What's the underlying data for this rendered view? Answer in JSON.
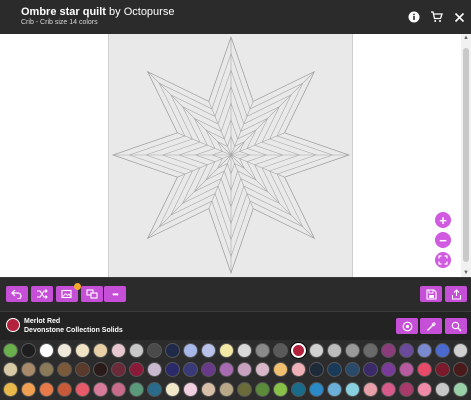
{
  "header": {
    "title": "Ombre star quilt",
    "by_author": "by Octopurse",
    "subtitle": "Crib - Crib size 14 colors"
  },
  "icons": {
    "info": "info-icon",
    "cart": "cart-icon",
    "close": "close-icon",
    "undo": "undo-icon",
    "shuffle": "shuffle-icon",
    "add_photo": "add-photo-icon",
    "swap": "swap-icon",
    "more": "more-icon",
    "save": "save-icon",
    "share": "share-icon",
    "zoom_in": "zoom-in-icon",
    "zoom_out": "zoom-out-icon",
    "fit": "fit-screen-icon",
    "color_wheel": "color-wheel-icon",
    "eyedropper": "eyedropper-icon",
    "search": "search-icon"
  },
  "colors": {
    "accent": "#c64fd8",
    "header_bg": "#2b2b2b",
    "badge": "#f7a72a"
  },
  "toolbar": {
    "more_label": "•••"
  },
  "selected_fabric": {
    "name": "Merlot Red",
    "collection": "Devonstone Collection Solids",
    "color": "#b4213c"
  },
  "palette": {
    "rows": [
      [
        "#6ab04c",
        "#1e1e1e",
        "#ffffff",
        "#efe9dc",
        "#f0e3c4",
        "#e8cfa6",
        "#e8c8d0",
        "#c9c9c9",
        "#4a4a4a",
        "#1f2a4a",
        "#a7b8e8",
        "#b9c2e8",
        "#f3e8a6",
        "#d8d8d8",
        "#8a8a8a",
        "#5a5a5a",
        "#b4213c",
        "#d2d2d2",
        "#bdbdbd",
        "#9a9a9a",
        "#6a6a6a",
        "#8a3c7a",
        "#6a4a9a",
        "#7a8ad0",
        "#4a6ad0",
        "#d0d0d0"
      ],
      [
        "#d8c9a6",
        "#a88a6a",
        "#8a7a5a",
        "#7a5a3a",
        "#5a3a2a",
        "#2a1a1a",
        "#6a2a3a",
        "#8a1a3a",
        "#c8b8d0",
        "#2a2a6a",
        "#3a3a7a",
        "#6a3a8a",
        "#a86ab0",
        "#c8a0c0",
        "#d8b8c8",
        "#f0c070",
        "#f0b0b8",
        "#1e2a3a",
        "#1a3a5a",
        "#2a4a6a",
        "#3a2a6a",
        "#7a3a9a",
        "#b85aa0",
        "#e84a6a",
        "#7a1a2a",
        "#4a1a1a"
      ],
      [
        "#e8b84a",
        "#f0a050",
        "#e87a4a",
        "#c85a3a",
        "#e85a6a",
        "#d87a9a",
        "#c86a8a",
        "#5a9a7a",
        "#2a6a8a",
        "#f0e8c8",
        "#f0d0e0",
        "#d8c0a8",
        "#b8a888",
        "#6a6a3a",
        "#5a8a3a",
        "#88c048",
        "#1a6a8a",
        "#2a8ac8",
        "#6ab0d8",
        "#88d0e0",
        "#e8a0a8",
        "#d85a8a",
        "#a83a6a",
        "#ef8aa8",
        "#c8c8c8",
        "#9ad0a8"
      ]
    ],
    "selected_row": 0,
    "selected_index": 16
  }
}
